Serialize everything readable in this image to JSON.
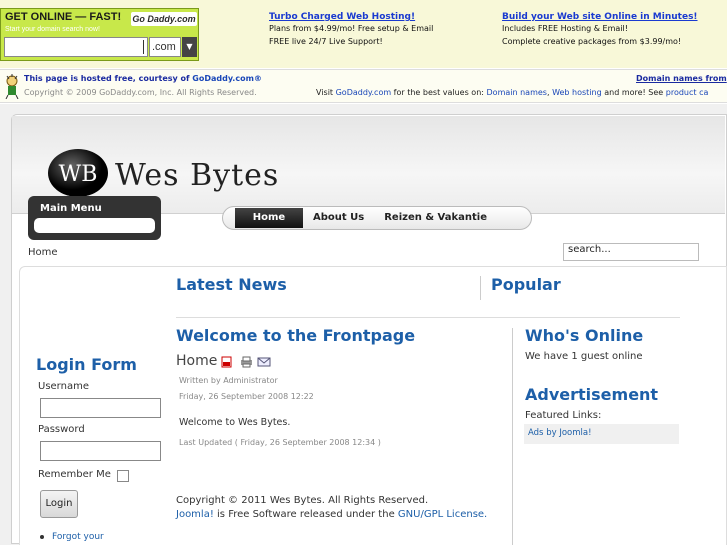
{
  "ad_bar": {
    "promo_title": "GET ONLINE — FAST!",
    "promo_subtitle": "Start your domain search now!",
    "promo_logo": "Go Daddy.com",
    "domain_suffix": ".com",
    "col1": {
      "heading": "Turbo Charged Web Hosting!",
      "line1": "Plans from $4.99/mo! Free setup & Email",
      "line2": "FREE live 24/7 Live Support!"
    },
    "col2": {
      "heading": "Build your Web site Online in Minutes!",
      "line1": "Includes FREE Hosting & Email!",
      "line2": "Complete creative packages from $3.99/mo!"
    }
  },
  "hosted_bar": {
    "line1_prefix": "This page is hosted free, courtesy of ",
    "line1_link": "GoDaddy.com®",
    "copyright": "Copyright © 2009 GoDaddy.com, Inc. All Rights Reserved.",
    "right_link": "Domain names from",
    "visit_prefix": "Visit ",
    "visit_link": "GoDaddy.com",
    "visit_mid": " for the best values on: ",
    "link_domains": "Domain names",
    "link_hosting": "Web hosting",
    "visit_tail": " and more! See ",
    "link_product": "product ca"
  },
  "site": {
    "name": "Wes Bytes",
    "logo_text": "WB",
    "nav": [
      "Home",
      "About Us",
      "Reizen & Vakantie"
    ],
    "breadcrumb": "Home",
    "search_placeholder": "search...",
    "main_menu_title": "Main Menu"
  },
  "login": {
    "title": "Login Form",
    "username_label": "Username",
    "password_label": "Password",
    "remember_label": "Remember Me",
    "button": "Login",
    "forgot": "Forgot your"
  },
  "center": {
    "latest_news": "Latest News",
    "popular": "Popular",
    "article_title": "Welcome to the Frontpage",
    "home": "Home",
    "author": "Written by Administrator",
    "date": "Friday, 26 September 2008 12:22",
    "body": "Welcome to Wes Bytes.",
    "updated": "Last Updated ( Friday, 26 September 2008 12:34 )",
    "footer_copyright": "Copyright © 2011 Wes Bytes. All Rights Reserved.",
    "footer_joomla": "Joomla!",
    "footer_mid": " is Free Software released under the ",
    "footer_license": "GNU/GPL License."
  },
  "right": {
    "whos_online": "Who's Online",
    "online_text": "We have 1 guest online",
    "advertisement": "Advertisement",
    "featured": "Featured Links:",
    "ads_link": "Ads by Joomla!"
  },
  "colors": {
    "link": "#1d5fa8",
    "promo": "#c8e84a",
    "ad_heading": "#1a3ad0"
  }
}
